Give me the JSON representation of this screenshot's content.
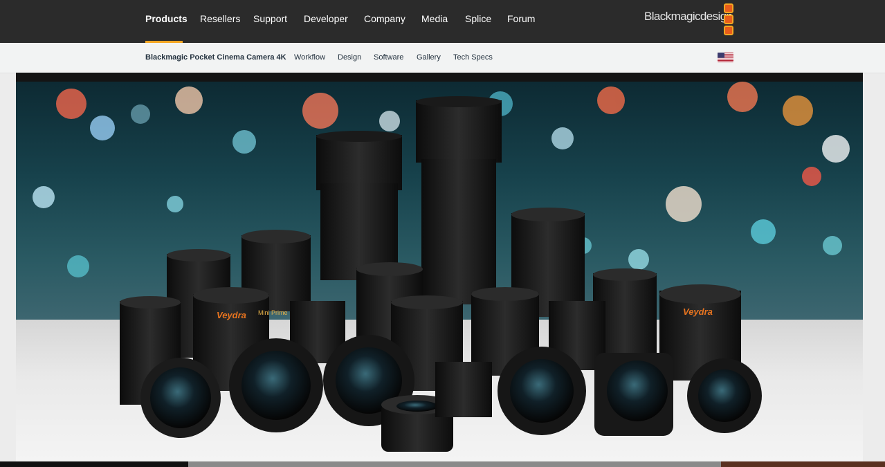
{
  "topnav": {
    "items": [
      {
        "label": "Products",
        "active": true
      },
      {
        "label": "Resellers"
      },
      {
        "label": "Support"
      },
      {
        "label": "Developer"
      },
      {
        "label": "Company"
      },
      {
        "label": "Media"
      },
      {
        "label": "Splice"
      },
      {
        "label": "Forum"
      }
    ],
    "logo_text": "Blackmagicdesign"
  },
  "subnav": {
    "product": "Blackmagic Pocket Cinema Camera 4K",
    "items": [
      "Workflow",
      "Design",
      "Software",
      "Gallery",
      "Tech Specs"
    ],
    "region_flag": "us-flag-icon"
  },
  "hero": {
    "description_icon": "camera-lenses-image",
    "lens_labels": [
      "Veydra",
      "Veydra",
      "Mini Prime"
    ]
  },
  "colors": {
    "topnav_bg": "#2b2b2b",
    "accent": "#f5a623",
    "logo_orange": "#e85d1b",
    "subnav_bg": "#f2f3f3",
    "subnav_text": "#24323f"
  }
}
